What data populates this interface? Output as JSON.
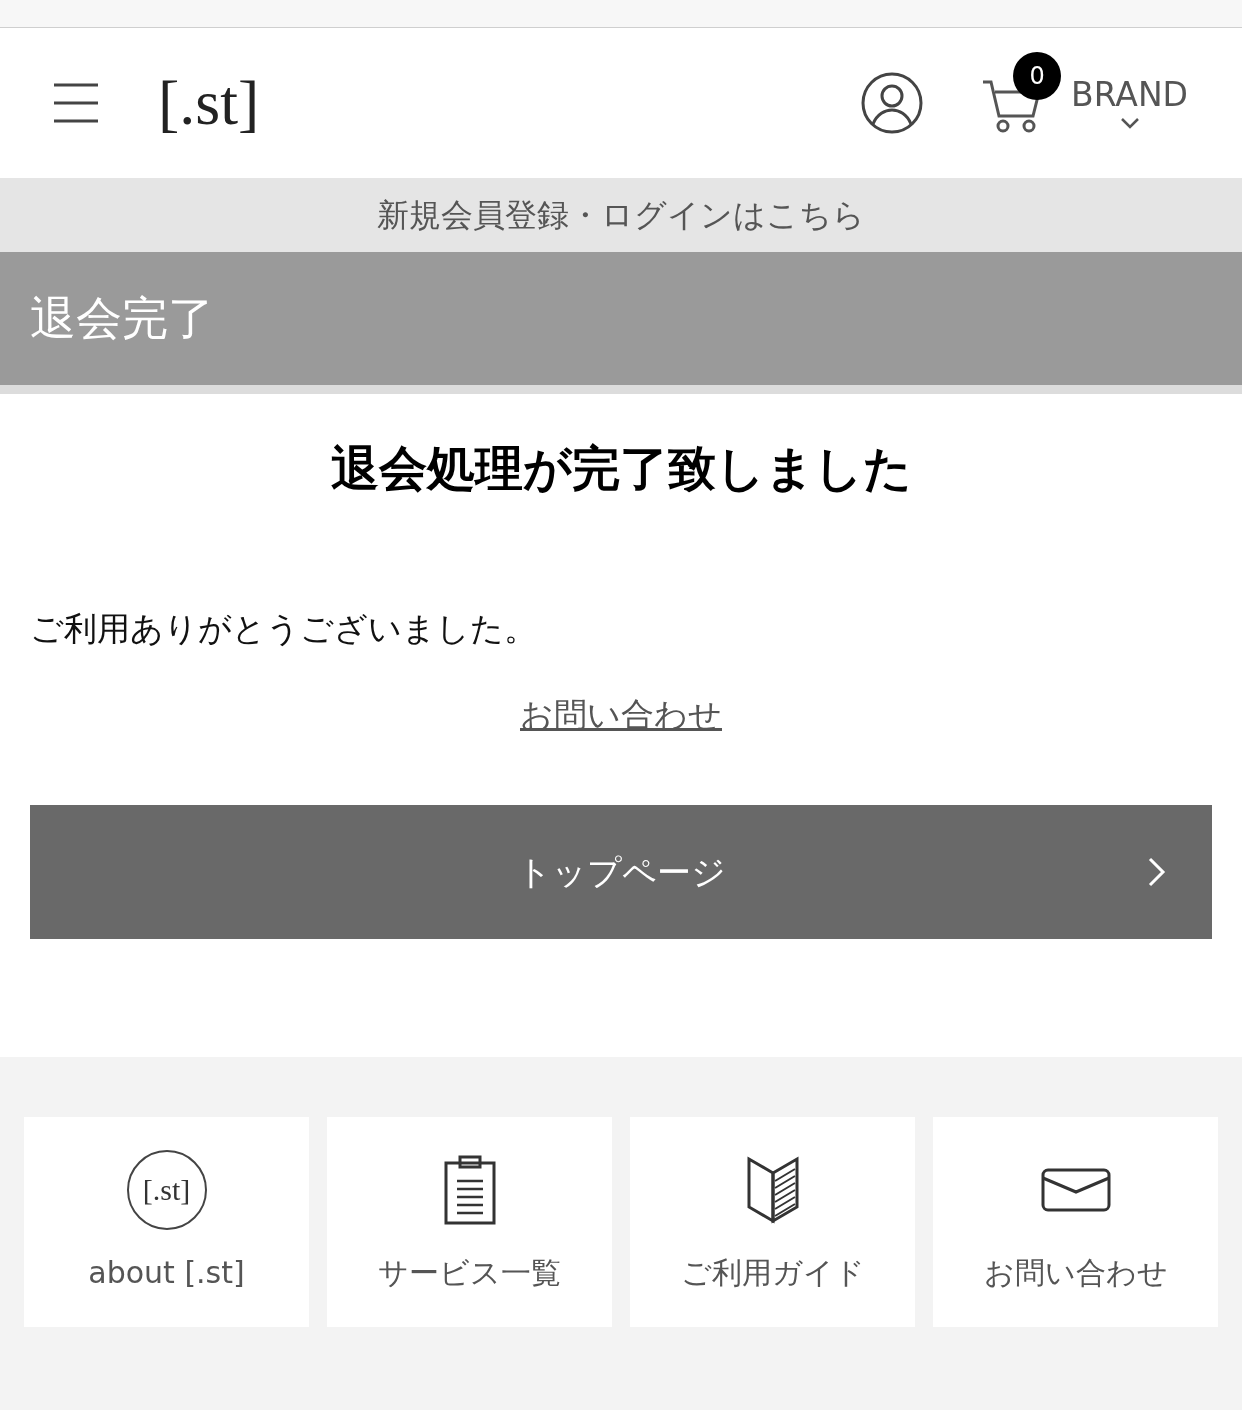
{
  "header": {
    "logo": "[.st]",
    "cart_count": "0",
    "brand": "BRAND"
  },
  "login_bar": "新規会員登録・ログインはこちら",
  "page_title": "退会完了",
  "heading": "退会処理が完了致しました",
  "message": "ご利用ありがとうございました。",
  "contact_link": "お問い合わせ",
  "top_button": "トップページ",
  "footer_items": [
    {
      "kind": "logo",
      "icon_text": "[.st]",
      "label": "about [.st]"
    },
    {
      "kind": "clipboard",
      "label": "サービス一覧"
    },
    {
      "kind": "book",
      "label": "ご利用ガイド"
    },
    {
      "kind": "mail",
      "label": "お問い合わせ"
    }
  ]
}
